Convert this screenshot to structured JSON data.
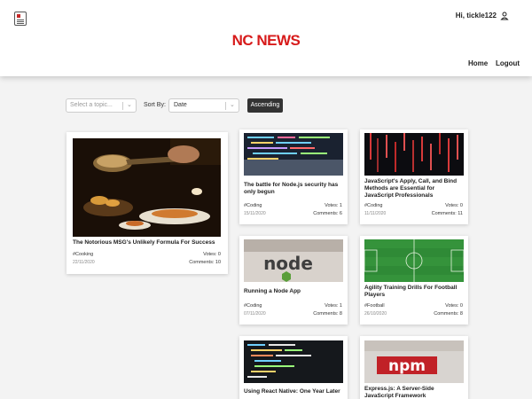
{
  "header": {
    "brand": "NC NEWS",
    "greeting": "Hi, tickle122",
    "nav": {
      "home": "Home",
      "logout": "Logout"
    }
  },
  "filters": {
    "topic_placeholder": "Select a topic...",
    "sort_label": "Sort By:",
    "sort_value": "Date",
    "order_button": "Ascending"
  },
  "articles": [
    {
      "title": "The Notorious MSG's Unlikely Formula For Success",
      "topic": "#Cooking",
      "votes": "Votes: 0",
      "date": "22/11/2020",
      "comments": "Comments: 10"
    },
    {
      "title": "The battle for Node.js security has only begun",
      "topic": "#Coding",
      "votes": "Votes: 1",
      "date": "15/11/2020",
      "comments": "Comments: 6"
    },
    {
      "title": "JavaScript's Apply, Call, and Bind Methods are Essential for JavaScript Professionals",
      "topic": "#Coding",
      "votes": "Votes: 0",
      "date": "11/11/2020",
      "comments": "Comments: 11"
    },
    {
      "title": "Running a Node App",
      "topic": "#Coding",
      "votes": "Votes: 1",
      "date": "07/11/2020",
      "comments": "Comments: 8"
    },
    {
      "title": "Agility Training Drills For Football Players",
      "topic": "#Football",
      "votes": "Votes: 0",
      "date": "26/10/2020",
      "comments": "Comments: 8"
    },
    {
      "title": "Using React Native: One Year Later",
      "topic": "",
      "votes": "",
      "date": "",
      "comments": ""
    },
    {
      "title": "Express.js: A Server-Side JavaScript Framework",
      "topic": "",
      "votes": "",
      "date": "",
      "comments": ""
    }
  ],
  "images": {
    "node_logo_text": "node",
    "npm_logo_text": "npm"
  },
  "icons": {
    "logo": "newspaper-icon",
    "user": "user-icon",
    "chevron": "chevron-down-icon"
  },
  "colors": {
    "brand": "#d71b1b",
    "button_bg": "#333333"
  }
}
